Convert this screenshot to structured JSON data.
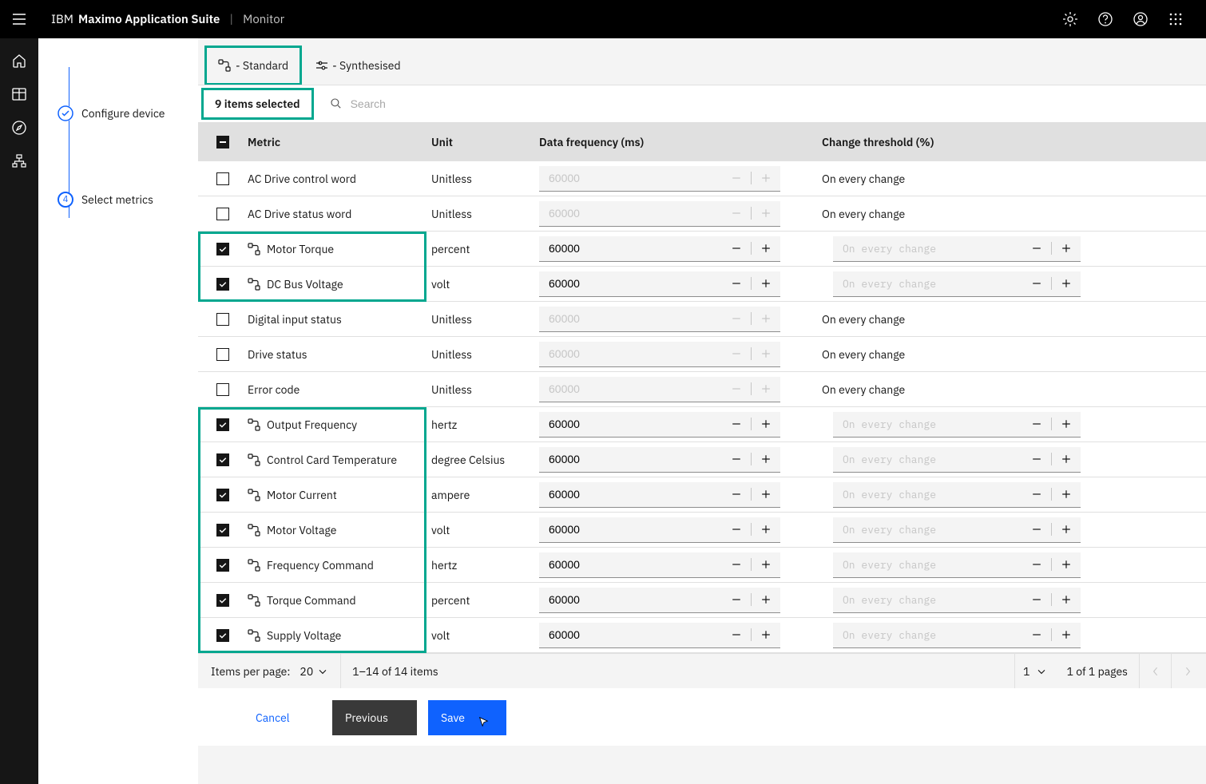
{
  "header": {
    "brand_prefix": "IBM",
    "brand_main": "Maximo Application Suite",
    "product": "Monitor"
  },
  "steps": {
    "configure": "Configure device",
    "select": "Select metrics",
    "select_num": "4"
  },
  "tabs": {
    "standard": "- Standard",
    "synthesised": "- Synthesised"
  },
  "toolbar": {
    "selected": "9 items selected",
    "search_placeholder": "Search"
  },
  "columns": {
    "metric": "Metric",
    "unit": "Unit",
    "freq": "Data frequency (ms)",
    "thr": "Change threshold (%)"
  },
  "defaults": {
    "freq_value": "60000",
    "freq_placeholder": "60000",
    "thr_text": "On every change",
    "thr_placeholder": "On every change"
  },
  "rows": [
    {
      "checked": false,
      "icon": false,
      "metric": "AC Drive control word",
      "unit": "Unitless",
      "hl": 0
    },
    {
      "checked": false,
      "icon": false,
      "metric": "AC Drive status word",
      "unit": "Unitless",
      "hl": 0
    },
    {
      "checked": true,
      "icon": true,
      "metric": "Motor Torque",
      "unit": "percent",
      "hl": 1
    },
    {
      "checked": true,
      "icon": true,
      "metric": "DC Bus Voltage",
      "unit": "volt",
      "hl": 1
    },
    {
      "checked": false,
      "icon": false,
      "metric": "Digital input status",
      "unit": "Unitless",
      "hl": 0
    },
    {
      "checked": false,
      "icon": false,
      "metric": "Drive status",
      "unit": "Unitless",
      "hl": 0
    },
    {
      "checked": false,
      "icon": false,
      "metric": "Error code",
      "unit": "Unitless",
      "hl": 0
    },
    {
      "checked": true,
      "icon": true,
      "metric": "Output Frequency",
      "unit": "hertz",
      "hl": 2
    },
    {
      "checked": true,
      "icon": true,
      "metric": "Control Card Temperature",
      "unit": "degree Celsius",
      "hl": 2
    },
    {
      "checked": true,
      "icon": true,
      "metric": "Motor Current",
      "unit": "ampere",
      "hl": 2
    },
    {
      "checked": true,
      "icon": true,
      "metric": "Motor Voltage",
      "unit": "volt",
      "hl": 2
    },
    {
      "checked": true,
      "icon": true,
      "metric": "Frequency Command",
      "unit": "hertz",
      "hl": 2
    },
    {
      "checked": true,
      "icon": true,
      "metric": "Torque Command",
      "unit": "percent",
      "hl": 2
    },
    {
      "checked": true,
      "icon": true,
      "metric": "Supply Voltage",
      "unit": "volt",
      "hl": 2
    }
  ],
  "pagination": {
    "label": "Items per page:",
    "per": "20",
    "range": "1–14 of 14 items",
    "page": "1",
    "pages": "1 of 1 pages"
  },
  "footer": {
    "cancel": "Cancel",
    "previous": "Previous",
    "save": "Save"
  }
}
